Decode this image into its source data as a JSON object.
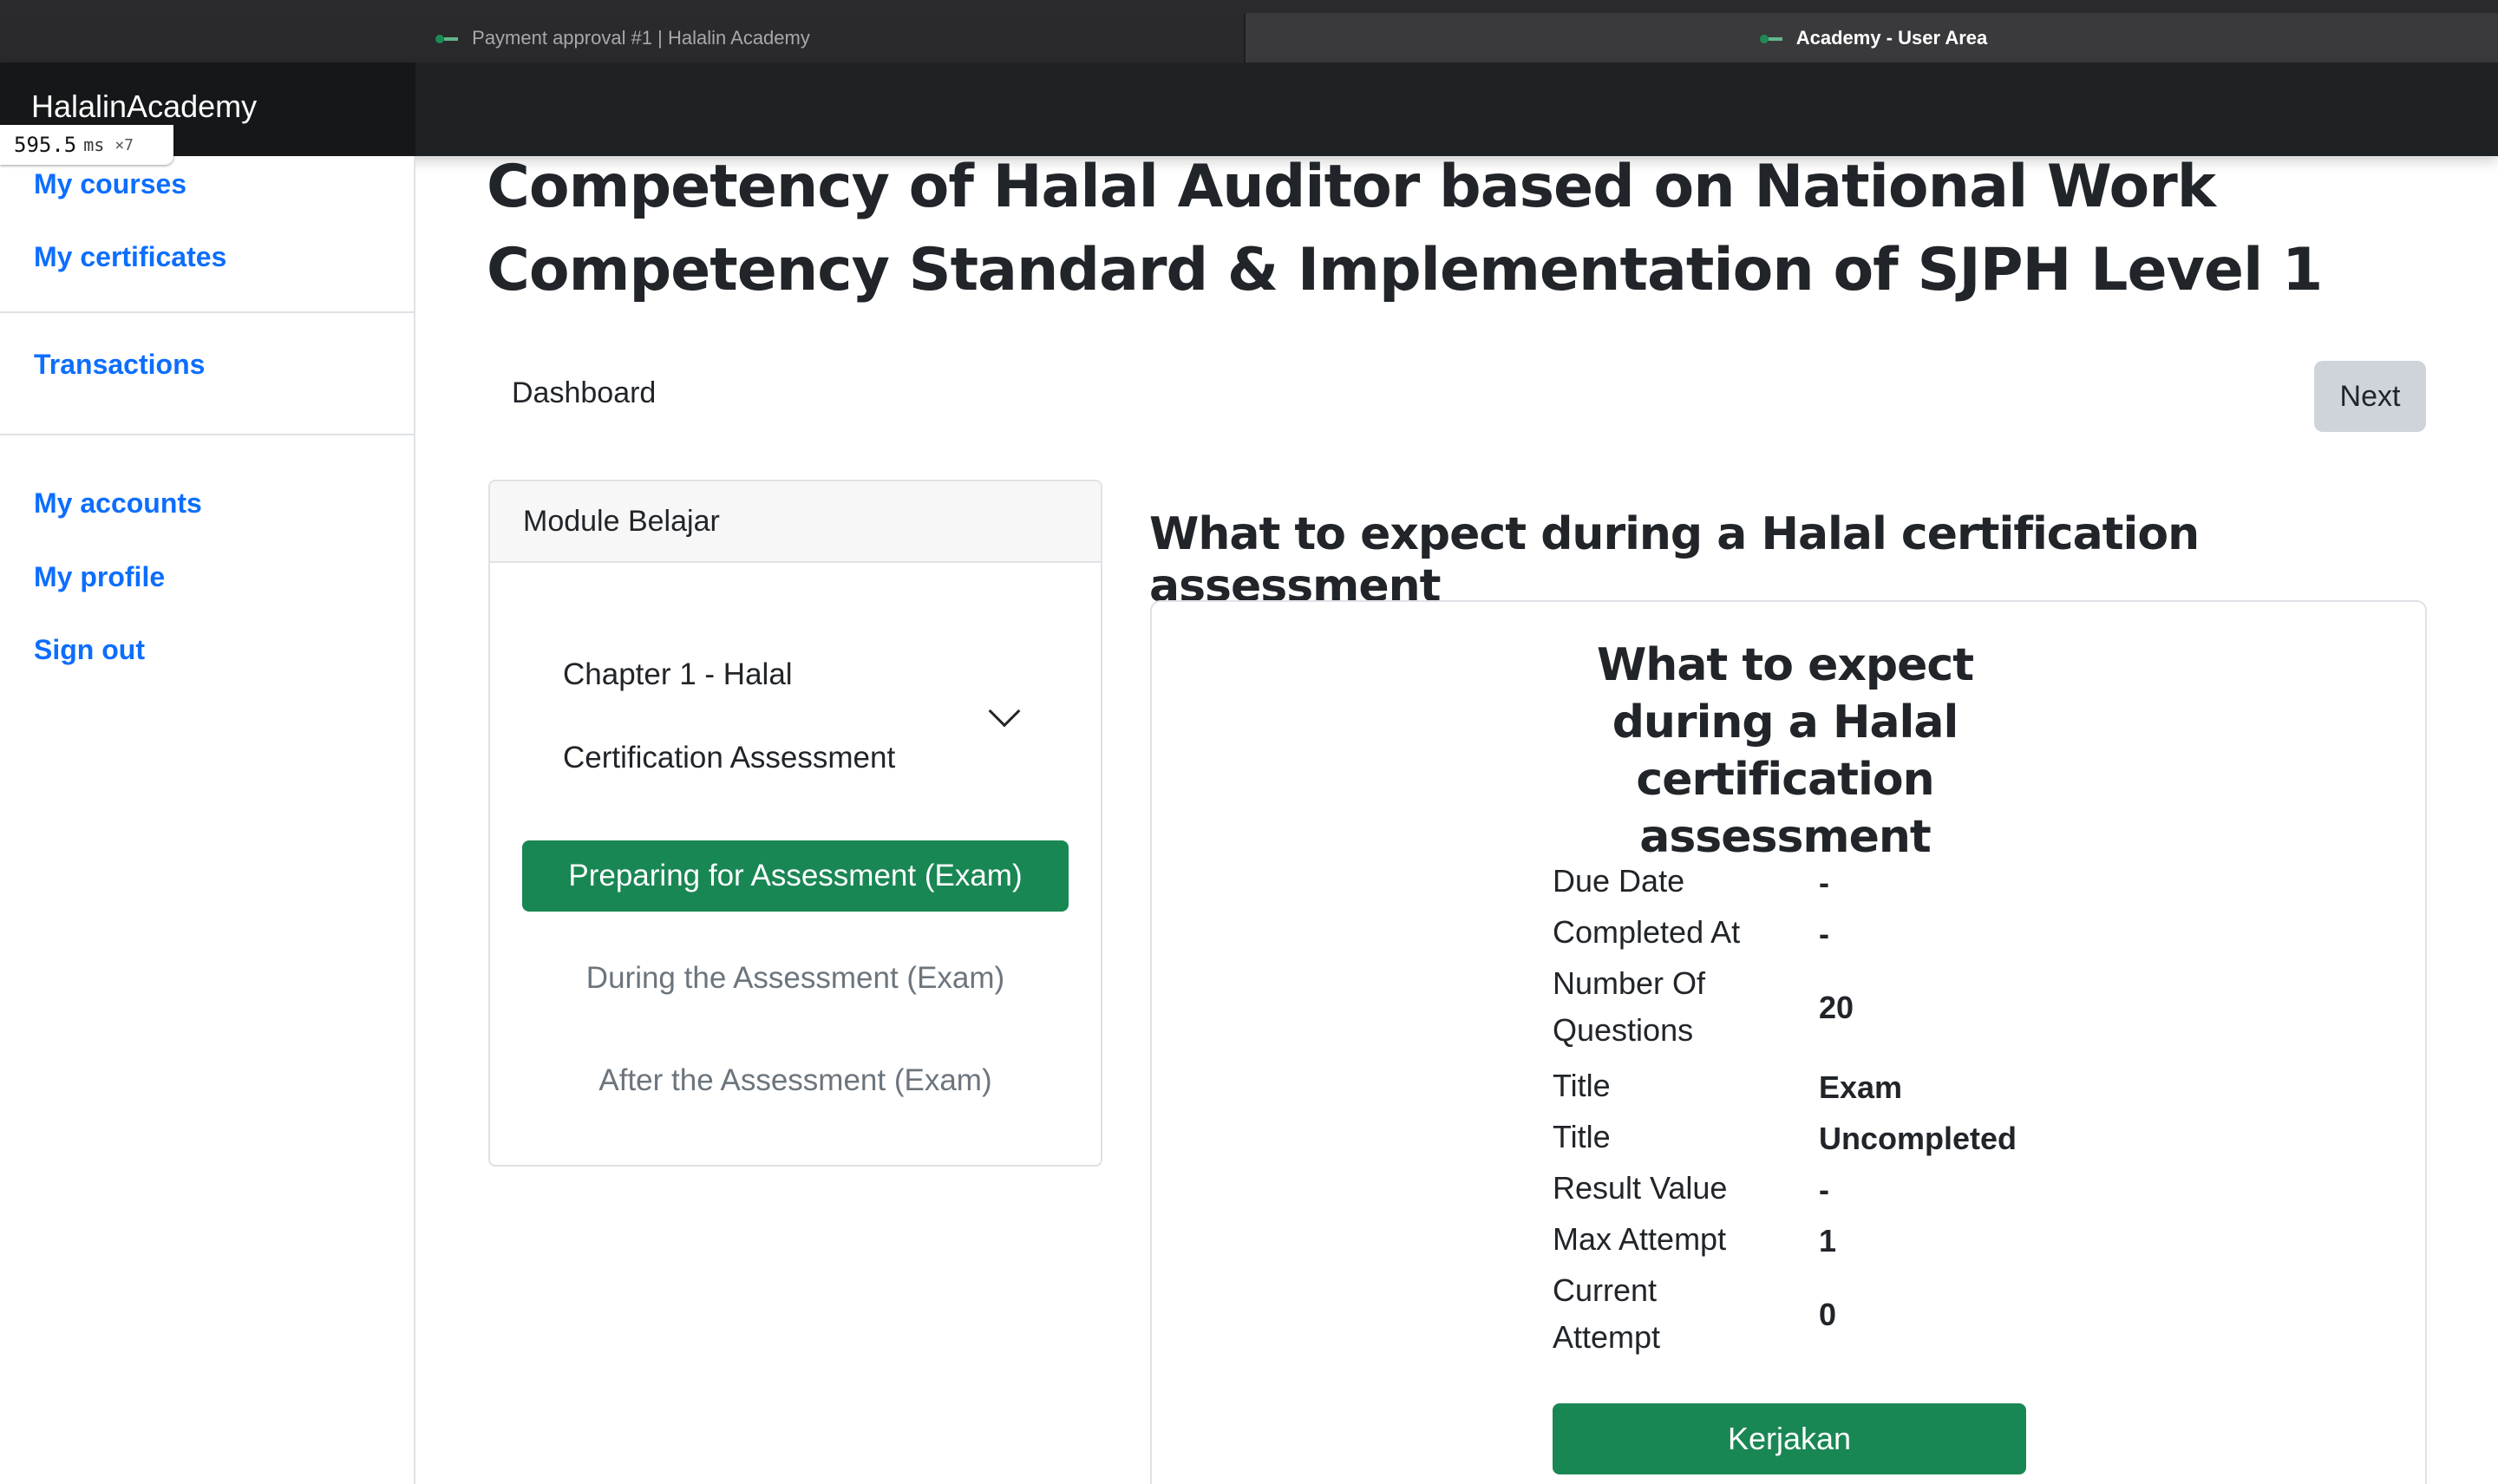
{
  "browser": {
    "tabs": [
      {
        "title": "Payment approval #1 | Halalin Academy",
        "active": false
      },
      {
        "title": "Academy - User Area",
        "active": true
      }
    ]
  },
  "perf_badge": {
    "value": "595.5",
    "unit": "ms",
    "multiplier": "×7"
  },
  "header": {
    "brand": "HalalinAcademy"
  },
  "sidebar": {
    "items": [
      {
        "label": "My courses"
      },
      {
        "label": "My certificates"
      },
      {
        "label": "Transactions"
      },
      {
        "label": "My accounts"
      },
      {
        "label": "My profile"
      },
      {
        "label": "Sign out"
      }
    ]
  },
  "main": {
    "title": "Competency of Halal Auditor based on National Work Competency Standard & Implementation of SJPH Level 1",
    "breadcrumb": "Dashboard",
    "next_label": "Next"
  },
  "module": {
    "heading": "Module Belajar",
    "chapter": "Chapter 1 - Halal Certification Assessment",
    "lessons": [
      {
        "label": "Preparing for Assessment (Exam)",
        "active": true
      },
      {
        "label": "During the Assessment (Exam)",
        "active": false
      },
      {
        "label": "After the Assessment (Exam)",
        "active": false
      }
    ]
  },
  "content": {
    "section_title": "What to expect during a Halal certification assessment",
    "card_title": "What to expect during a Halal certification assessment",
    "details": [
      {
        "label": "Due Date",
        "value": "-"
      },
      {
        "label": "Completed At",
        "value": "-"
      },
      {
        "label": "Number Of Questions",
        "value": "20"
      },
      {
        "label": "Title",
        "value": "Exam"
      },
      {
        "label": "Title",
        "value": "Uncompleted"
      },
      {
        "label": "Result Value",
        "value": "-"
      },
      {
        "label": "Max Attempt",
        "value": "1"
      },
      {
        "label": "Current Attempt",
        "value": "0"
      }
    ],
    "action_label": "Kerjakan"
  },
  "colors": {
    "primary_link": "#0d6efd",
    "success": "#198754",
    "header_bg": "#1f2225"
  }
}
